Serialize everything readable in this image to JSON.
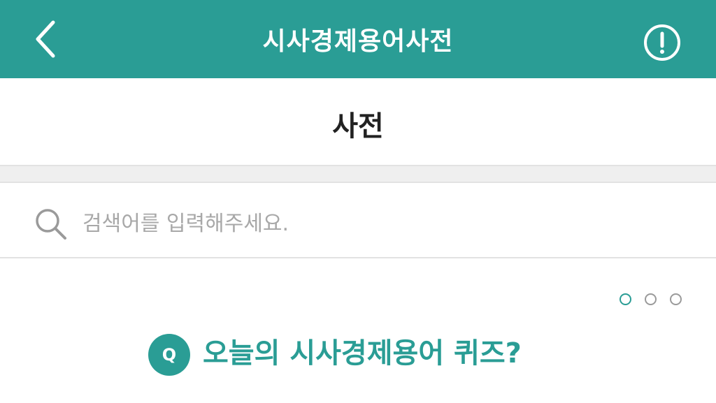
{
  "appbar": {
    "title": "시사경제용어사전",
    "back_icon": "chevron-left-icon",
    "info_icon": "info-circle-icon",
    "background_color": "#2a9d95"
  },
  "subheader": {
    "title": "사전"
  },
  "search": {
    "placeholder": "검색어를 입력해주세요.",
    "value": "",
    "icon": "search-icon"
  },
  "carousel": {
    "page_count": 3,
    "active_index": 0,
    "active_color": "#2a9d95"
  },
  "quiz": {
    "badge": "Q",
    "title": "오늘의 시사경제용어 퀴즈?",
    "color": "#2a9d95"
  }
}
